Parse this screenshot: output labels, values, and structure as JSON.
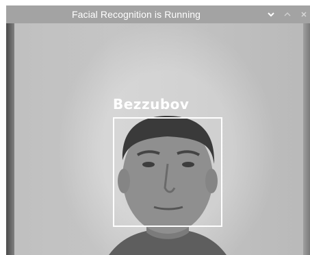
{
  "window": {
    "title": "Facial Recognition is Running",
    "controls": [
      {
        "name": "minimize-icon",
        "glyph": "chevron-down"
      },
      {
        "name": "maximize-icon",
        "glyph": "chevron-up"
      },
      {
        "name": "close-icon",
        "glyph": "x"
      }
    ]
  },
  "detection": {
    "label": "Bezzubov"
  },
  "colors": {
    "titlebar": "#a3a3a3",
    "title_text": "#ffffff",
    "box_stroke": "#ffffff"
  }
}
